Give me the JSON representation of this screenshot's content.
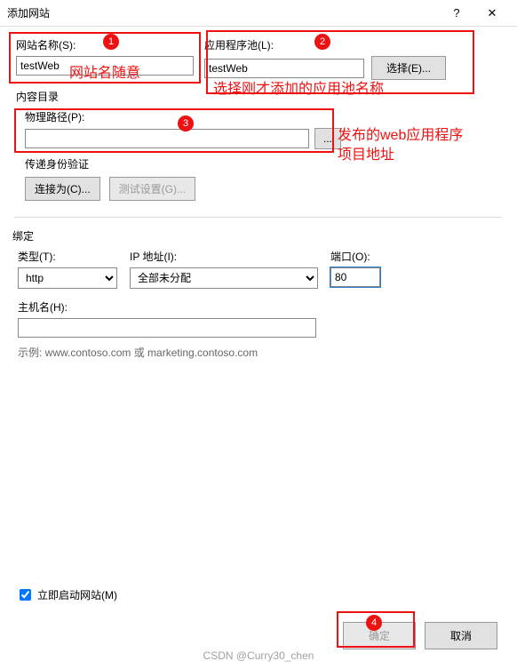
{
  "title": "添加网站",
  "site_name": {
    "label": "网站名称(S):",
    "value": "testWeb",
    "accel": "S"
  },
  "app_pool": {
    "label": "应用程序池(L):",
    "value": "testWeb",
    "select_btn": "选择(E)...",
    "accel": "L"
  },
  "content_dir_label": "内容目录",
  "physical_path": {
    "label": "物理路径(P):",
    "value": "",
    "browse": "...",
    "accel": "P"
  },
  "auth": {
    "label": "传递身份验证",
    "connect_as": "连接为(C)...",
    "test": "测试设置(G)..."
  },
  "binding": {
    "section": "绑定",
    "type_label": "类型(T):",
    "type_value": "http",
    "ip_label": "IP 地址(I):",
    "ip_value": "全部未分配",
    "port_label": "端口(O):",
    "port_value": "80",
    "host_label": "主机名(H):",
    "host_value": "",
    "example": "示例: www.contoso.com 或 marketing.contoso.com"
  },
  "start_immediately": {
    "label": "立即启动网站(M)",
    "checked": true
  },
  "buttons": {
    "ok": "确定",
    "cancel": "取消"
  },
  "annotations": {
    "badge1": "1",
    "badge2": "2",
    "badge3": "3",
    "badge4": "4",
    "site_name_hint": "网站名随意",
    "app_pool_hint": "选择刚才添加的应用池名称",
    "path_hint_line1": "发布的web应用程序",
    "path_hint_line2": "项目地址"
  },
  "watermark": "CSDN @Curry30_chen"
}
